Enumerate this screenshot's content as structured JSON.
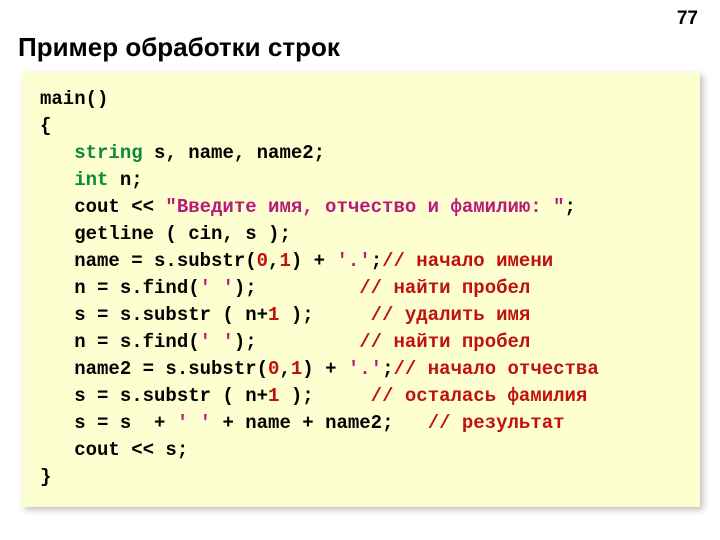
{
  "page": {
    "number": "77"
  },
  "title": "Пример обработки строк",
  "code": {
    "l01": "main()",
    "l02": "{",
    "l03_indent": "   ",
    "l03_kw": "string",
    "l03_rest": " s, name, name2;",
    "l04_indent": "   ",
    "l04_kw": "int",
    "l04_rest": " n;",
    "l05_full": "   cout << ",
    "l05_str": "\"Введите имя, отчество и фамилию: \"",
    "l05_end": ";",
    "l06": "   getline ( cin, s );",
    "l07_a": "   name = s.substr(",
    "l07_n1": "0",
    "l07_c": ",",
    "l07_n2": "1",
    "l07_b": ") + ",
    "l07_ch": "'.'",
    "l07_s": ";",
    "l07_cmt": "// начало имени",
    "l08_a": "   n = s.find(",
    "l08_ch": "' '",
    "l08_b": ");         ",
    "l08_cmt": "// найти пробел",
    "l09_a": "   s = s.substr ( n+",
    "l09_n": "1",
    "l09_b": " );     ",
    "l09_cmt": "// удалить имя",
    "l10_a": "   n = s.find(",
    "l10_ch": "' '",
    "l10_b": ");         ",
    "l10_cmt": "// найти пробел",
    "l11_a": "   name2 = s.substr(",
    "l11_n1": "0",
    "l11_c": ",",
    "l11_n2": "1",
    "l11_b": ") + ",
    "l11_ch": "'.'",
    "l11_s": ";",
    "l11_cmt": "// начало отчества",
    "l12_a": "   s = s.substr ( n+",
    "l12_n": "1",
    "l12_b": " );     ",
    "l12_cmt": "// осталась фамилия",
    "l13_a": "   s = s  + ",
    "l13_ch": "' '",
    "l13_b": " + name + name2;   ",
    "l13_cmt": "// результат",
    "l14": "   cout << s;",
    "l15": "}"
  }
}
